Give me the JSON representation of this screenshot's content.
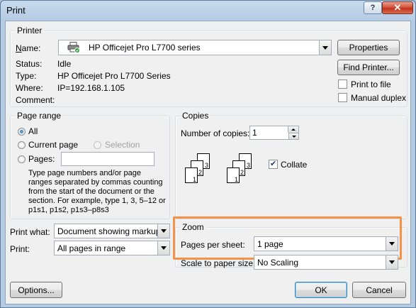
{
  "window": {
    "title": "Print",
    "help_label": "?",
    "close_label": "✕"
  },
  "printer": {
    "group_label": "Printer",
    "name_label": "Name:",
    "name_value": "HP Officejet Pro L7700 series",
    "status_label": "Status:",
    "status_value": "Idle",
    "type_label": "Type:",
    "type_value": "HP Officejet Pro L7700 Series",
    "where_label": "Where:",
    "where_value": "IP=192.168.1.105",
    "comment_label": "Comment:",
    "comment_value": "",
    "properties_button": "Properties",
    "find_printer_button": "Find Printer...",
    "print_to_file_label": "Print to file",
    "print_to_file_checked": false,
    "manual_duplex_label": "Manual duplex",
    "manual_duplex_checked": false
  },
  "page_range": {
    "group_label": "Page range",
    "all_label": "All",
    "current_page_label": "Current page",
    "selection_label": "Selection",
    "pages_label": "Pages:",
    "pages_value": "",
    "selected": "All",
    "help_text": "Type page numbers and/or page ranges separated by commas counting from the start of the document or the section. For example, type 1, 3, 5–12 or p1s1, p1s2, p1s3–p8s3"
  },
  "copies": {
    "group_label": "Copies",
    "number_label": "Number of copies:",
    "number_value": "1",
    "collate_label": "Collate",
    "collate_checked": true,
    "page_numbers": [
      "1",
      "2",
      "3"
    ]
  },
  "print_what": {
    "label": "Print what:",
    "value": "Document showing markup"
  },
  "print": {
    "label": "Print:",
    "value": "All pages in range"
  },
  "zoom": {
    "group_label": "Zoom",
    "pages_per_sheet_label": "Pages per sheet:",
    "pages_per_sheet_value": "1 page",
    "scale_label": "Scale to paper size:",
    "scale_value": "No Scaling",
    "highlight_color": "#f4914a"
  },
  "footer": {
    "options_button": "Options...",
    "ok_button": "OK",
    "cancel_button": "Cancel"
  }
}
